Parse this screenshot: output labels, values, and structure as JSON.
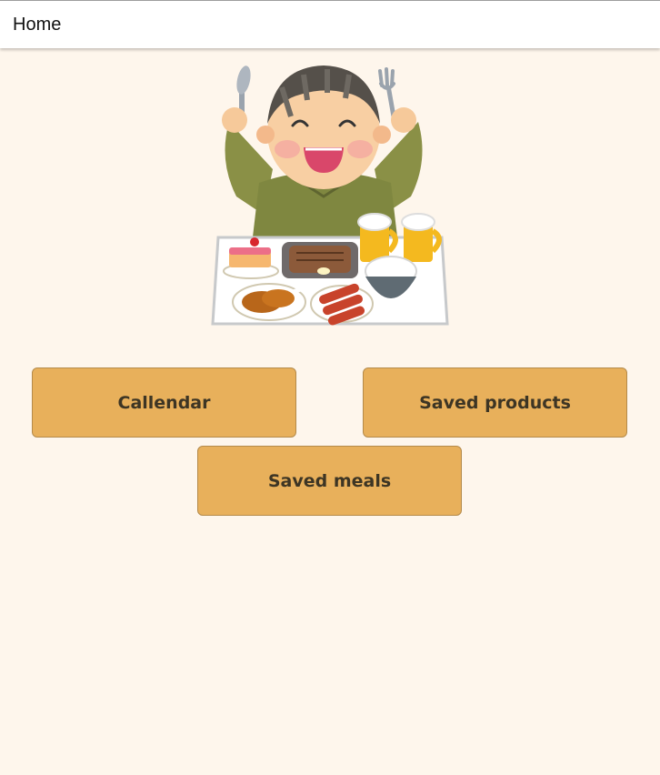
{
  "header": {
    "title": "Home"
  },
  "hero": {
    "image": "boy-eating-feast-illustration"
  },
  "buttons": {
    "calendar": "Callendar",
    "saved_products": "Saved products",
    "saved_meals": "Saved meals"
  },
  "colors": {
    "background": "#fef6ec",
    "button": "#e8b05b",
    "button_text": "#3d3524"
  }
}
